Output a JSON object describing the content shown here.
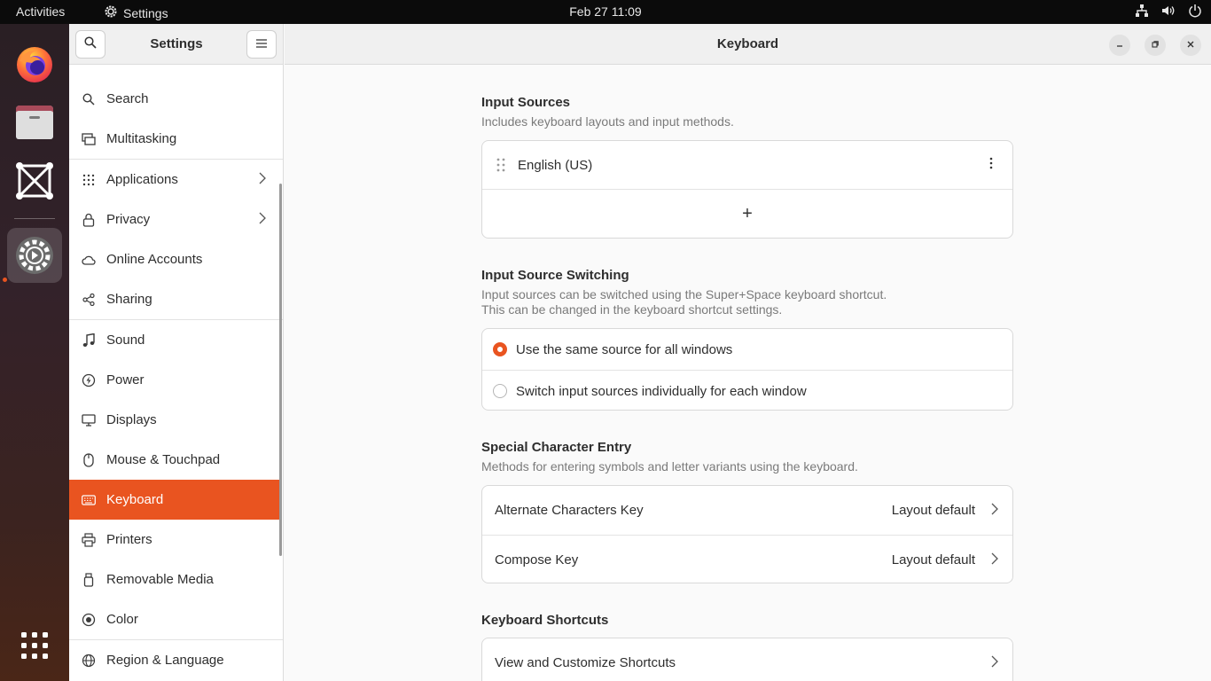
{
  "topbar": {
    "activities": "Activities",
    "app_name": "Settings",
    "clock": "Feb 27  11:09"
  },
  "dock": {
    "items": [
      "Firefox",
      "Files",
      "Screenshot",
      "Settings",
      "Show Applications"
    ]
  },
  "sidebar": {
    "title": "Settings",
    "items": [
      {
        "label": "Search"
      },
      {
        "label": "Multitasking"
      },
      {
        "label": "Applications"
      },
      {
        "label": "Privacy"
      },
      {
        "label": "Online Accounts"
      },
      {
        "label": "Sharing"
      },
      {
        "label": "Sound"
      },
      {
        "label": "Power"
      },
      {
        "label": "Displays"
      },
      {
        "label": "Mouse & Touchpad"
      },
      {
        "label": "Keyboard"
      },
      {
        "label": "Printers"
      },
      {
        "label": "Removable Media"
      },
      {
        "label": "Color"
      },
      {
        "label": "Region & Language"
      }
    ]
  },
  "content": {
    "title": "Keyboard",
    "input_sources": {
      "title": "Input Sources",
      "description": "Includes keyboard layouts and input methods.",
      "source": "English (US)",
      "add": "+"
    },
    "switching": {
      "title": "Input Source Switching",
      "description_line1": "Input sources can be switched using the Super+Space keyboard shortcut.",
      "description_line2": "This can be changed in the keyboard shortcut settings.",
      "option_same": "Use the same source for all windows",
      "option_individual": "Switch input sources individually for each window",
      "selected": "same"
    },
    "special": {
      "title": "Special Character Entry",
      "description": "Methods for entering symbols and letter variants using the keyboard.",
      "alternate_label": "Alternate Characters Key",
      "alternate_value": "Layout default",
      "compose_label": "Compose Key",
      "compose_value": "Layout default"
    },
    "shortcuts": {
      "title": "Keyboard Shortcuts",
      "view_label": "View and Customize Shortcuts"
    }
  },
  "colors": {
    "accent": "#e95420"
  }
}
